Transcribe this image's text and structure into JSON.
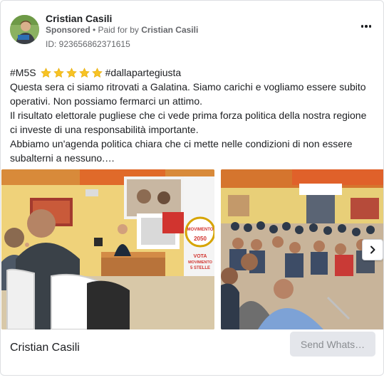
{
  "post": {
    "author": "Cristian Casili",
    "sponsored_label": "Sponsored",
    "paid_for_prefix": "• Paid for by",
    "paid_for_by": "Cristian Casili",
    "ad_id": "ID: 923656862371615",
    "more_icon": "more-horizontal-icon"
  },
  "body": {
    "hashtag_1": "#M5S",
    "stars_count": 5,
    "star_color": "#f7c325",
    "hashtag_2": "#dallapartegiusta",
    "line_1": "Questa sera ci siamo ritrovati a Galatina. Siamo carichi e vogliamo essere subito operativi. Non possiamo fermarci un attimo.",
    "line_2": "Il risultato elettorale pugliese che ci vede prima forza politica della nostra regione ci investe di una responsabilità importante.",
    "line_3": "Abbiamo un'agenda politica chiara che ci mette nelle condizioni di non essere subalterni a nessuno.…"
  },
  "carousel": {
    "banner_word": "MOVIMENTO",
    "banner_year": "2050",
    "vote_line_1": "VOTA",
    "vote_line_2": "MOVIMENTO",
    "vote_line_3": "5 STELLE",
    "next_icon": "chevron-right-icon"
  },
  "footer": {
    "page_name": "Cristian Casili",
    "cta_label": "Send Whats…"
  }
}
